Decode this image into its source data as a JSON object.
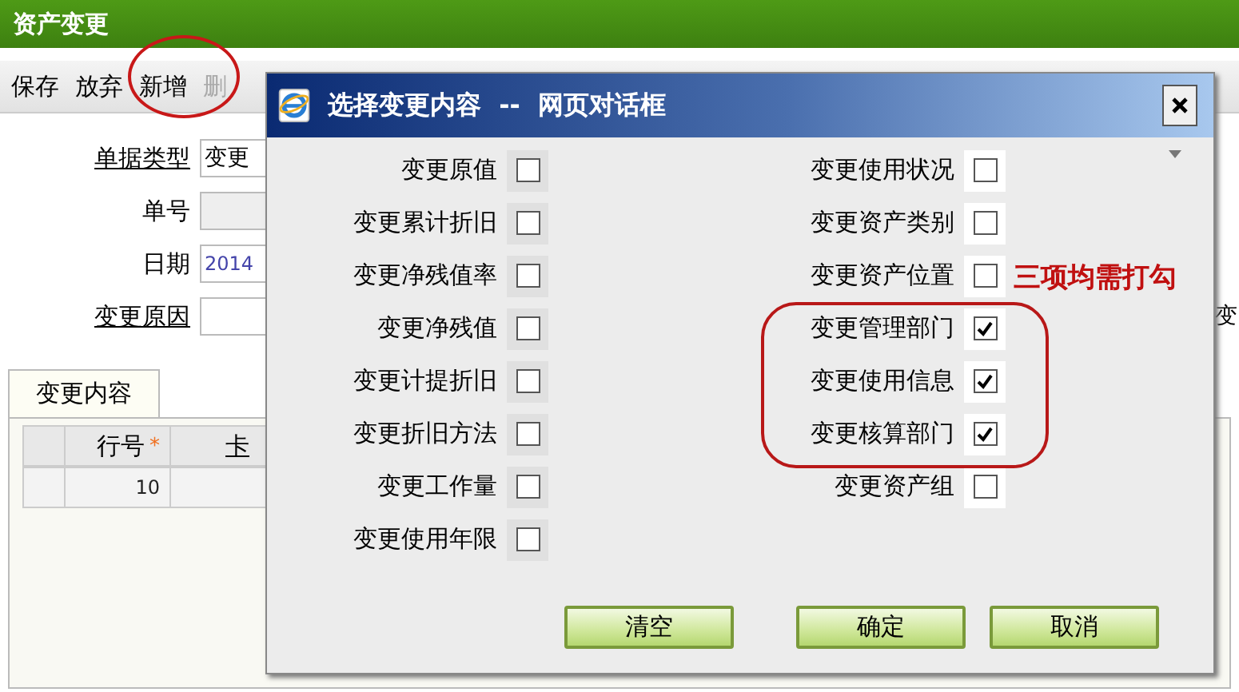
{
  "window": {
    "title": "资产变更"
  },
  "toolbar": [
    {
      "label": "保存",
      "disabled": false
    },
    {
      "label": "放弃",
      "disabled": false
    },
    {
      "label": "新增",
      "disabled": false
    },
    {
      "label": "删",
      "disabled": true
    }
  ],
  "form": [
    {
      "label": "单据类型",
      "link": true,
      "disabled": false,
      "value": "变更"
    },
    {
      "label": "单号",
      "link": false,
      "disabled": true
    },
    {
      "label": "日期",
      "link": false,
      "disabled": false,
      "value": "2014"
    },
    {
      "label": "变更原因",
      "link": true,
      "disabled": false,
      "edge": "变"
    }
  ],
  "tabs": [
    {
      "label": "变更内容",
      "selected": true
    }
  ],
  "grid": {
    "columns": [
      {
        "label": "行号",
        "required_mark": "*"
      },
      {
        "label": "卡"
      }
    ],
    "rows": [
      [
        "10"
      ]
    ]
  },
  "dialog": {
    "title": "选择变更内容  --  网页对话框",
    "left": [
      {
        "label": "变更原值",
        "checked": false
      },
      {
        "label": "变更累计折旧",
        "checked": false
      },
      {
        "label": "变更净残值率",
        "checked": false
      },
      {
        "label": "变更净残值",
        "checked": false
      },
      {
        "label": "变更计提折旧",
        "checked": false
      },
      {
        "label": "变更折旧方法",
        "checked": false
      },
      {
        "label": "变更工作量",
        "checked": false
      },
      {
        "label": "变更使用年限",
        "checked": false
      }
    ],
    "right": [
      {
        "label": "变更使用状况",
        "checked": false
      },
      {
        "label": "变更资产类别",
        "checked": false
      },
      {
        "label": "变更资产位置",
        "checked": false
      },
      {
        "label": "变更管理部门",
        "checked": true
      },
      {
        "label": "变更使用信息",
        "checked": true
      },
      {
        "label": "变更核算部门",
        "checked": true
      },
      {
        "label": "变更资产组",
        "checked": false
      }
    ],
    "buttons": [
      "清空",
      "确定",
      "取消"
    ]
  },
  "annotation": {
    "text": "三项均需打勾"
  }
}
